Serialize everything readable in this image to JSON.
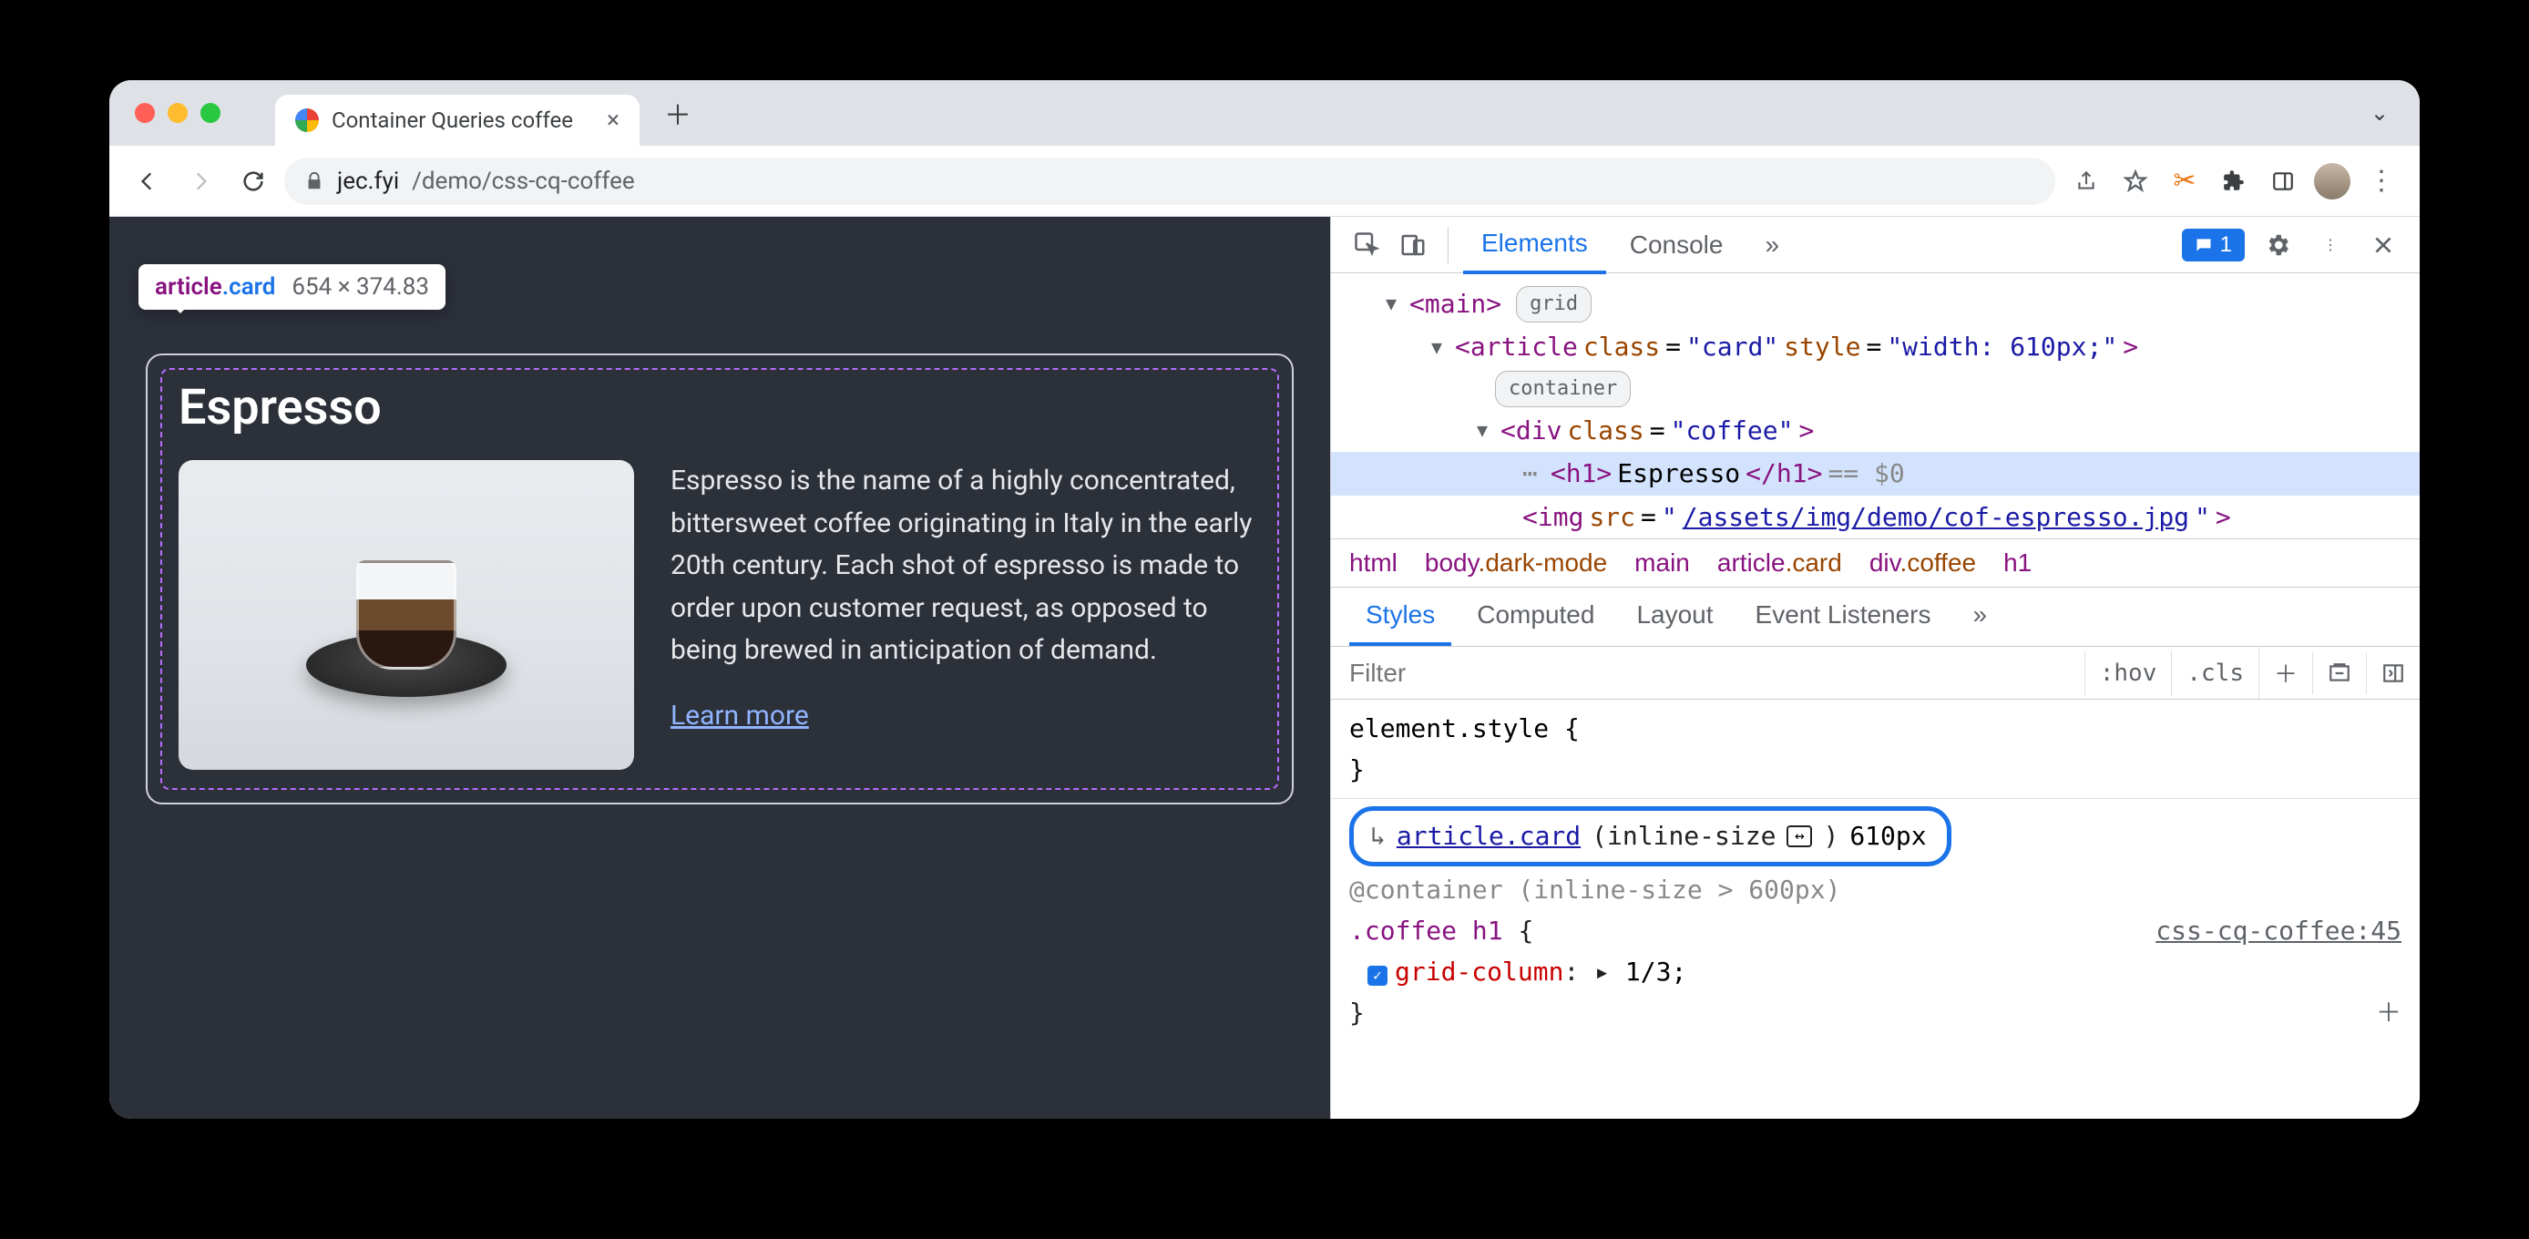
{
  "tab": {
    "title": "Container Queries coffee"
  },
  "url": {
    "host": "jec.fyi",
    "path": "/demo/css-cq-coffee"
  },
  "inspect_tooltip": {
    "tag": "article",
    "cls": ".card",
    "dims": "654 × 374.83"
  },
  "page": {
    "title": "Espresso",
    "desc": "Espresso is the name of a highly concentrated, bittersweet coffee originating in Italy in the early 20th century. Each shot of espresso is made to order upon customer request, as opposed to being brewed in anticipation of demand.",
    "learn": "Learn more"
  },
  "devtools": {
    "tabs": {
      "elements": "Elements",
      "console": "Console"
    },
    "badge_count": "1",
    "dom": {
      "main_open": "<main>",
      "main_pill": "grid",
      "article_open": "<article class=\"card\" style=\"width: 610px;\">",
      "article_pill": "container",
      "div_open": "<div class=\"coffee\">",
      "h1": "<h1>Espresso</h1>",
      "h1_eq": " == $0",
      "img_pre": "<img src=\"",
      "img_src": "/assets/img/demo/cof-espresso.jpg",
      "img_post": "\">"
    },
    "crumbs": [
      "html",
      "body.dark-mode",
      "main",
      "article.card",
      "div.coffee",
      "h1"
    ],
    "styles_tabs": [
      "Styles",
      "Computed",
      "Layout",
      "Event Listeners"
    ],
    "filter_placeholder": "Filter",
    "hov": ":hov",
    "cls": ".cls",
    "styles": {
      "elstyle": "element.style {",
      "brace_close": "}",
      "container_link": "article.card",
      "container_query": "(inline-size",
      "container_val": "610px",
      "at_rule": "@container (inline-size > 600px)",
      "rule_sel": ".coffee h1 {",
      "src": "css-cq-coffee:45",
      "prop": "grid-column",
      "val": "1/3;"
    }
  }
}
